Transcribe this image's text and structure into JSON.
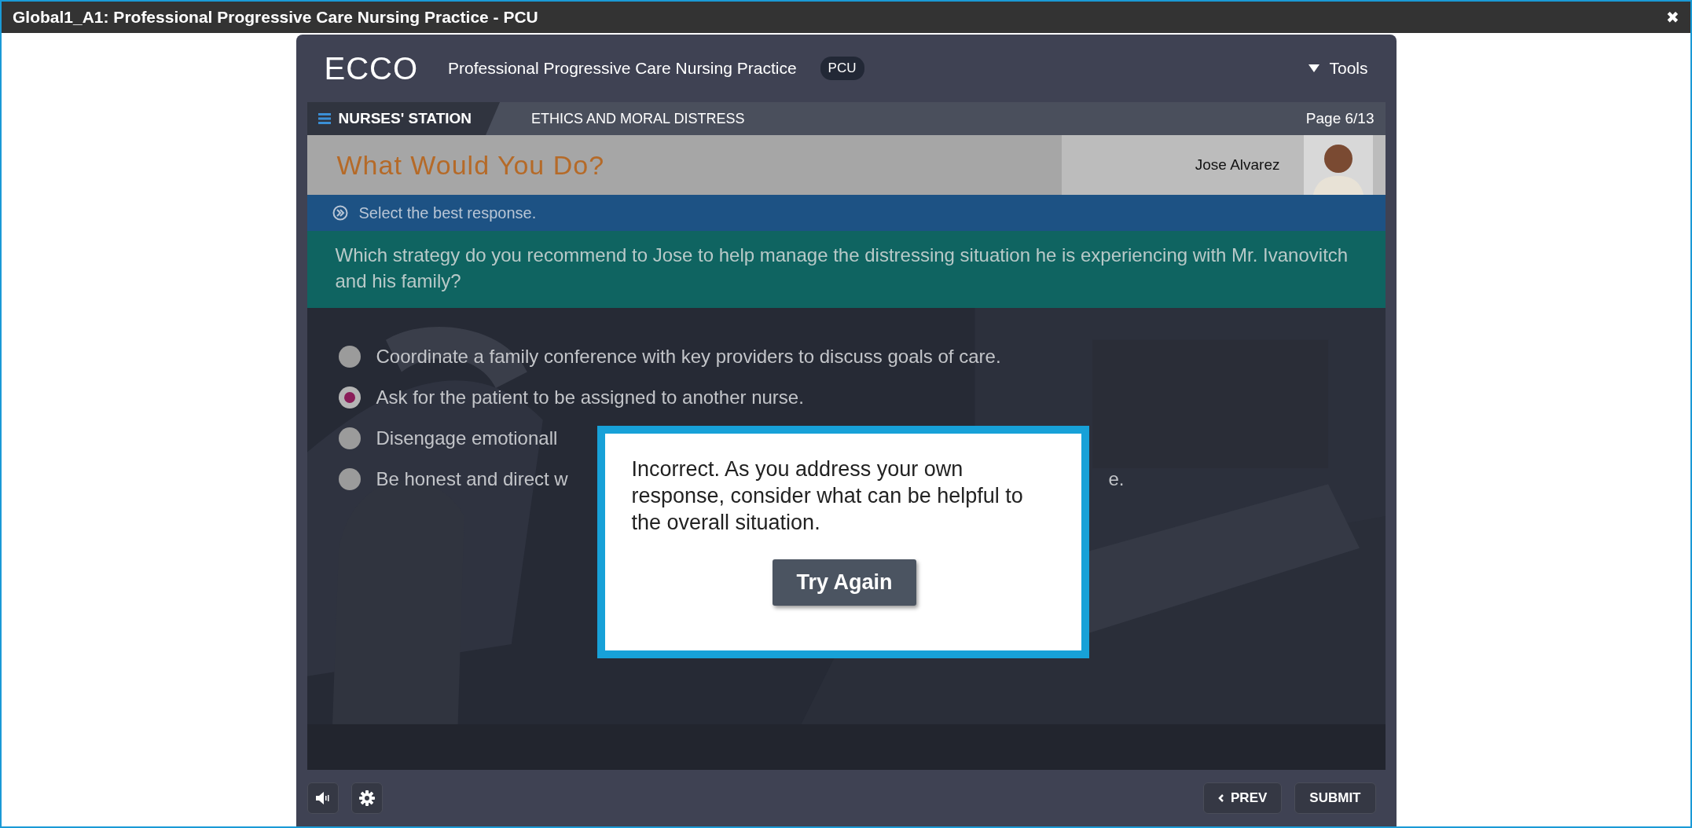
{
  "window": {
    "title": "Global1_A1: Professional Progressive Care Nursing Practice - PCU",
    "close": "✖"
  },
  "header": {
    "logo": "ECCO",
    "course_title": "Professional Progressive Care Nursing Practice",
    "badge": "PCU",
    "tools": "Tools"
  },
  "nav": {
    "station": "NURSES' STATION",
    "section": "ETHICS AND MORAL DISTRESS",
    "page": "Page 6/13"
  },
  "banner": {
    "title": "What Would You Do?",
    "person": "Jose Alvarez"
  },
  "instruction": "Select the best response.",
  "question": "Which strategy do you recommend to Jose to help manage the distressing situation he is experiencing with Mr. Ivanovitch and his family?",
  "options": [
    {
      "text": "Coordinate a family conference with key providers to discuss goals of care.",
      "selected": false
    },
    {
      "text": "Ask for the patient to be assigned to another nurse.",
      "selected": true
    },
    {
      "text": "Disengage emotionall",
      "selected": false
    },
    {
      "text": "Be honest and direct w",
      "tail": "e.",
      "selected": false
    }
  ],
  "feedback": {
    "message": "Incorrect. As you address your own response, consider what can be helpful to the overall situation.",
    "button": "Try Again"
  },
  "footer": {
    "prev": "PREV",
    "submit": "SUBMIT"
  }
}
